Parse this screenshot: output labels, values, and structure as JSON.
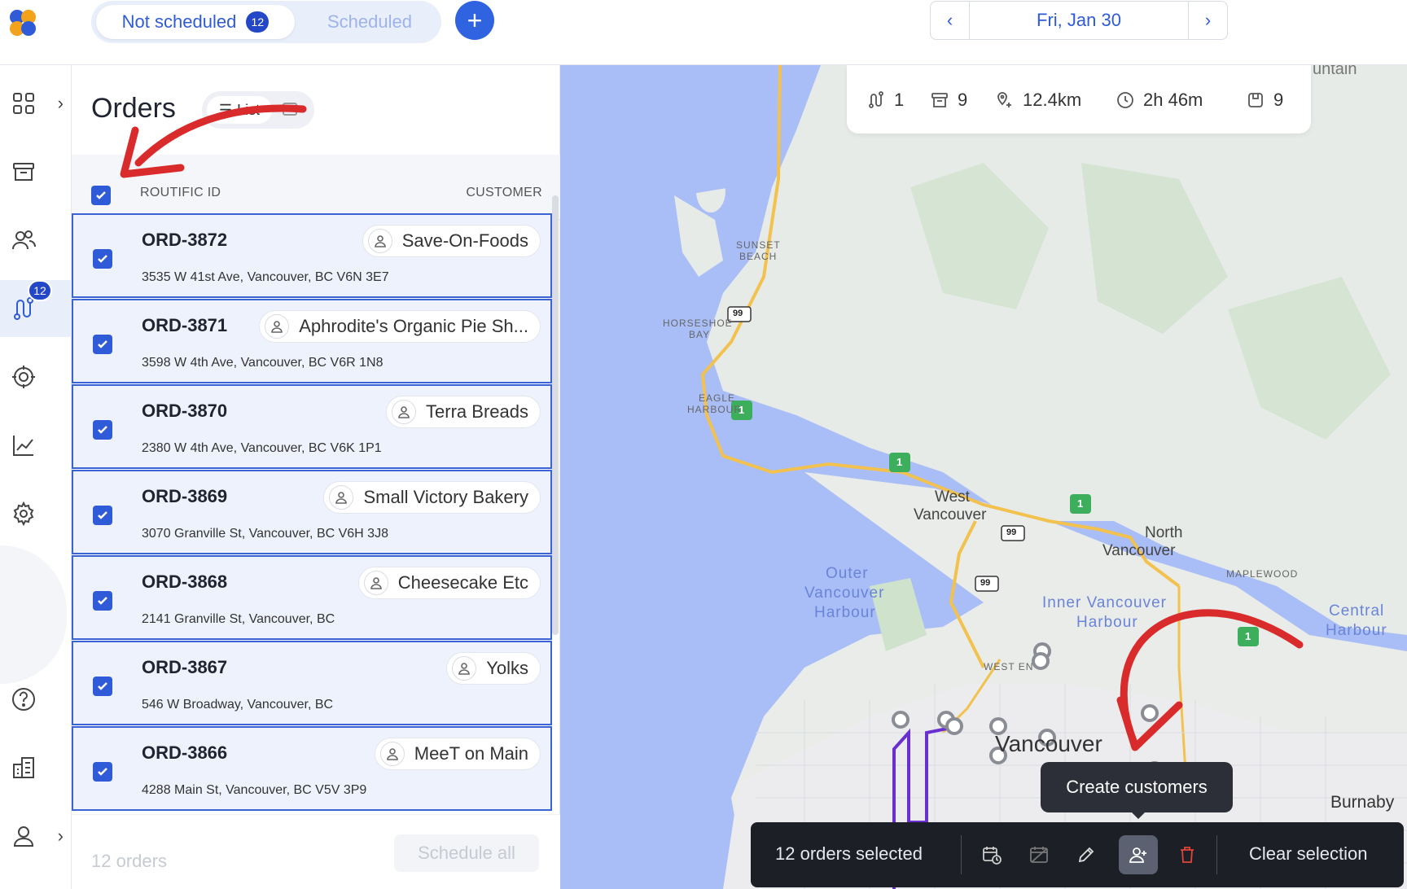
{
  "header": {
    "tabs": [
      {
        "label": "Not scheduled",
        "badge": "12",
        "active": true
      },
      {
        "label": "Scheduled",
        "active": false
      }
    ],
    "add_button_label": "+",
    "date_nav": {
      "date": "Fri, Jan 30",
      "prev": "‹",
      "next": "›"
    }
  },
  "leftnav": {
    "items": [
      {
        "name": "dashboard",
        "icon": "grid-icon",
        "has_chevron": true
      },
      {
        "name": "orders",
        "icon": "archive-icon"
      },
      {
        "name": "customers",
        "icon": "users-icon"
      },
      {
        "name": "routes",
        "icon": "route-icon",
        "badge": "12",
        "active": true
      },
      {
        "name": "tracking",
        "icon": "target-icon"
      },
      {
        "name": "analytics",
        "icon": "chart-icon"
      },
      {
        "name": "settings",
        "icon": "gear-icon"
      },
      {
        "name": "help",
        "icon": "help-icon"
      },
      {
        "name": "company",
        "icon": "building-icon"
      },
      {
        "name": "account",
        "icon": "user-icon",
        "has_chevron": true
      }
    ]
  },
  "orders": {
    "title": "Orders",
    "view_label": "List",
    "columns": {
      "id": "ROUTIFIC ID",
      "customer": "CUSTOMER"
    },
    "rows": [
      {
        "id": "ORD-3872",
        "customer": "Save-On-Foods",
        "address": "3535 W 41st Ave, Vancouver, BC V6N 3E7"
      },
      {
        "id": "ORD-3871",
        "customer": "Aphrodite's Organic Pie Sh...",
        "address": "3598 W 4th Ave, Vancouver, BC V6R 1N8"
      },
      {
        "id": "ORD-3870",
        "customer": "Terra Breads",
        "address": "2380 W 4th Ave, Vancouver, BC V6K 1P1"
      },
      {
        "id": "ORD-3869",
        "customer": "Small Victory Bakery",
        "address": "3070 Granville St, Vancouver, BC V6H 3J8"
      },
      {
        "id": "ORD-3868",
        "customer": "Cheesecake Etc",
        "address": "2141 Granville St, Vancouver, BC"
      },
      {
        "id": "ORD-3867",
        "customer": "Yolks",
        "address": "546 W Broadway, Vancouver, BC"
      },
      {
        "id": "ORD-3866",
        "customer": "MeeT on Main",
        "address": "4288 Main St, Vancouver, BC V5V 3P9"
      }
    ],
    "footer": {
      "count": "12 orders",
      "schedule_all": "Schedule all"
    }
  },
  "stats": [
    {
      "icon": "route-icon",
      "value": "1"
    },
    {
      "icon": "archive-icon",
      "value": "9"
    },
    {
      "icon": "distance-icon",
      "value": "12.4km"
    },
    {
      "icon": "clock-icon",
      "value": "2h 46m"
    },
    {
      "icon": "box-icon",
      "value": "9"
    }
  ],
  "map": {
    "labels": {
      "mountain": "untain",
      "sunset": "SUNSET",
      "beach": "BEACH",
      "horseshoe": "HORSESHOE",
      "bay": "BAY",
      "eagle": "EAGLE",
      "harbour": "HARBOUR",
      "west": "West",
      "vancouver_w": "Vancouver",
      "north": "North",
      "vancouver_n": "Vancouver",
      "outer1": "Outer",
      "outer2": "Vancouver",
      "outer3": "Harbour",
      "inner1": "Inner Vancouver",
      "inner2": "Harbour",
      "maplewood": "MAPLEWOOD",
      "central1": "Central",
      "central2": "Harbour",
      "westend": "WEST EN",
      "vancouver": "Vancouver",
      "burnaby": "Burnaby",
      "hwy99": "99",
      "hwy1": "1"
    }
  },
  "actionbar": {
    "selected": "12 orders selected",
    "clear": "Clear selection",
    "tooltip": "Create customers"
  },
  "colors": {
    "primary": "#2f5bd8",
    "badge": "#2347c6",
    "row_border": "#3a63d6",
    "water": "#a9bdf7",
    "land": "#e7ebe8",
    "route": "#6a2fd0",
    "annotation": "#d92b2b"
  }
}
